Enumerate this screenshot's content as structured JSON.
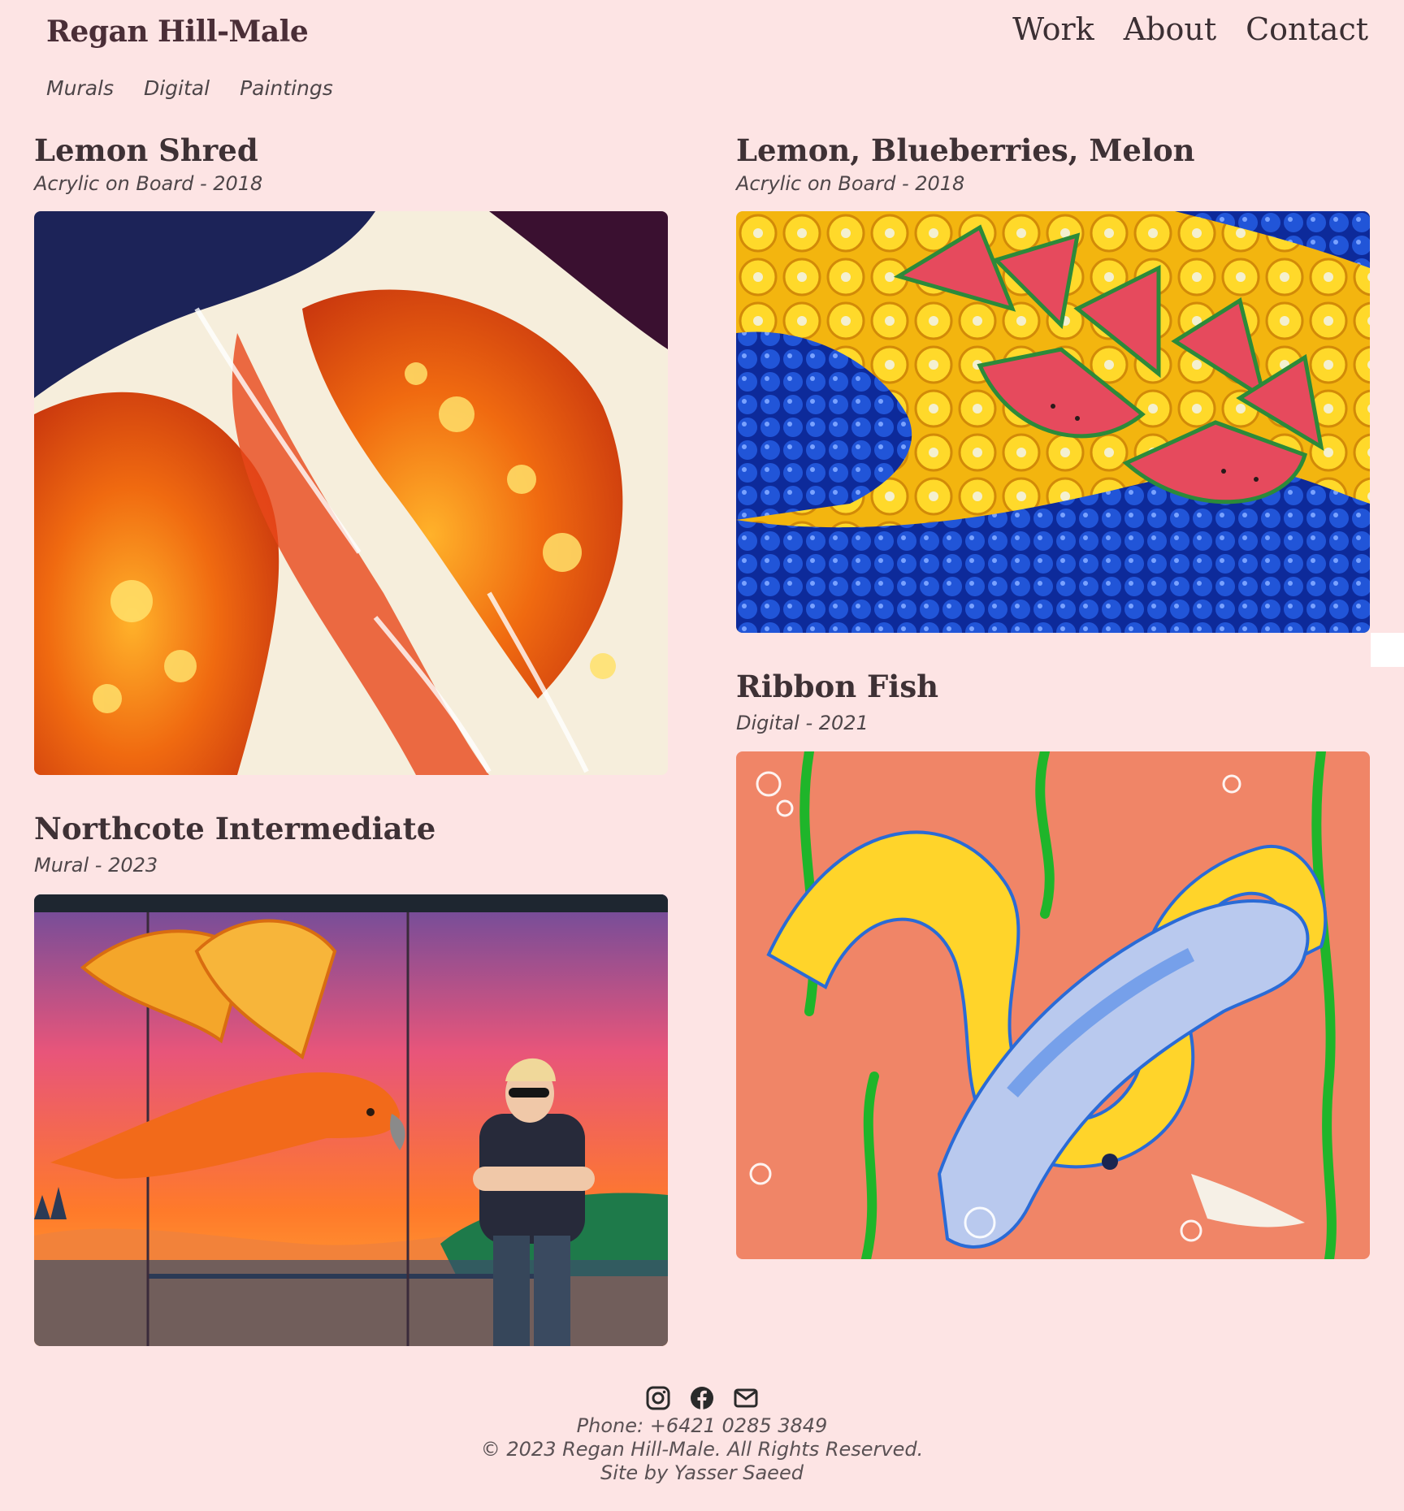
{
  "site": {
    "brand": "Regan Hill-Male",
    "nav": [
      "Work",
      "About",
      "Contact"
    ],
    "categories": [
      "Murals",
      "Digital",
      "Paintings"
    ]
  },
  "works": [
    {
      "title": "Lemon Shred",
      "meta": "Acrylic on Board - 2018"
    },
    {
      "title": "Lemon, Blueberries, Melon",
      "meta": "Acrylic on Board - 2018"
    },
    {
      "title": "Ribbon Fish",
      "meta": "Digital - 2021"
    },
    {
      "title": "Northcote Intermediate",
      "meta": "Mural - 2023"
    }
  ],
  "footer": {
    "phone": "Phone: +6421 0285 3849",
    "copyright": "© 2023 Regan Hill-Male. All Rights Reserved.",
    "credit": "Site by Yasser Saeed",
    "social_icons": [
      "instagram-icon",
      "facebook-icon",
      "email-icon"
    ]
  },
  "colors": {
    "background": "#fde4e4",
    "text": "#3f2f33"
  }
}
